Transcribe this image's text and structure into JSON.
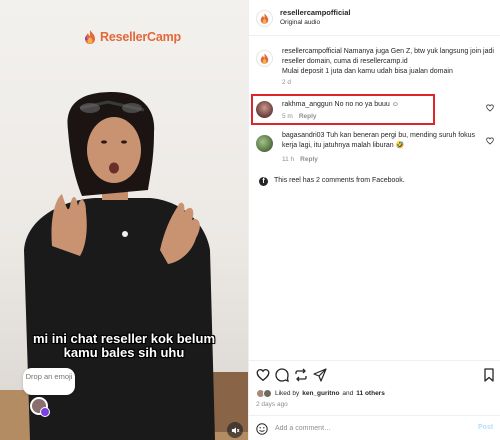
{
  "video": {
    "brand": "ResellerCamp",
    "caption_line1": "mi ini chat reseller kok belum",
    "caption_line2": "kamu bales sih uhu",
    "drop_emoji": "Drop an emoji"
  },
  "header": {
    "username": "resellercampofficial",
    "subtitle": "Original audio"
  },
  "post_caption": {
    "text": "resellercampofficial Namanya juga Gen Z, btw yuk langsung join jadi reseller domain, cuma di resellercamp.id",
    "text2": "Mulai deposit 1 juta dan kamu udah bisa jualan domain",
    "time": "2 d"
  },
  "comments": [
    {
      "text": "rakhma_anggun No no no ya buuu ☺",
      "time": "5 m",
      "reply": "Reply"
    },
    {
      "text": "bagasandri03 Tuh kan beneran pergi bu, mending suruh fokus kerja lagi, itu jatuhnya malah liburan 🤣",
      "time": "11 h",
      "reply": "Reply"
    }
  ],
  "facebook_note": "This reel has 2 comments from Facebook.",
  "likes": {
    "prefix": "Liked by",
    "user": "ken_guritno",
    "and": "and",
    "others": "11 others",
    "date": "2 days ago"
  },
  "comment_box": {
    "placeholder": "Add a comment…",
    "post": "Post"
  },
  "colors": {
    "brand_orange": "#e3683a",
    "highlight_red": "#e0242b",
    "post_blue": "#b2dffc"
  }
}
